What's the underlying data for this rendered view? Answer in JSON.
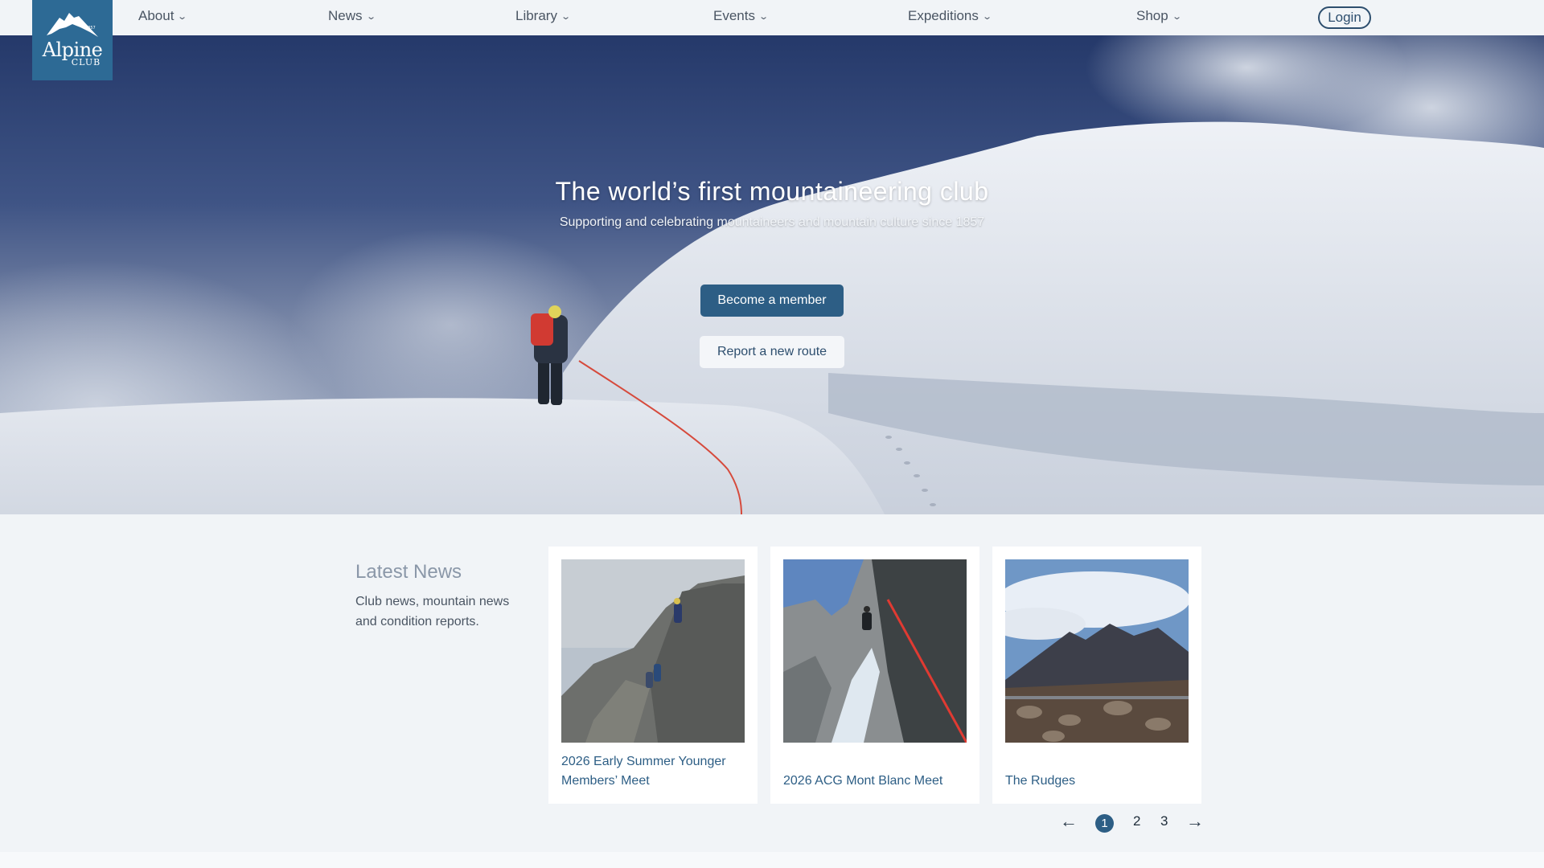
{
  "nav": {
    "logo": {
      "year": "1857",
      "line1": "Alpine",
      "line2": "CLUB"
    },
    "items": [
      {
        "label": "About"
      },
      {
        "label": "News"
      },
      {
        "label": "Library"
      },
      {
        "label": "Events"
      },
      {
        "label": "Expeditions"
      },
      {
        "label": "Shop"
      }
    ],
    "login_label": "Login",
    "chevron_icon": "chevron-down-icon"
  },
  "hero": {
    "title": "The world’s first mountaineering club",
    "subtitle": "Supporting and celebrating mountaineers and mountain culture since 1857",
    "primary_button": "Become a member",
    "secondary_button": "Report a new route"
  },
  "news": {
    "heading": "Latest News",
    "description": "Club news, mountain news and condition reports.",
    "cards": [
      {
        "title": "2026 Early Summer Younger Members’ Meet"
      },
      {
        "title": "2026 ACG Mont Blanc Meet"
      },
      {
        "title": "The Rudges"
      }
    ],
    "pagination": {
      "prev_icon": "arrow-left-icon",
      "pages": [
        "1",
        "2",
        "3"
      ],
      "current": "1",
      "next_icon": "arrow-right-icon"
    }
  },
  "colors": {
    "brand": "#2d6a95",
    "primary_button": "#2d5e85",
    "link": "#2d5e85",
    "background": "#f1f4f7"
  }
}
